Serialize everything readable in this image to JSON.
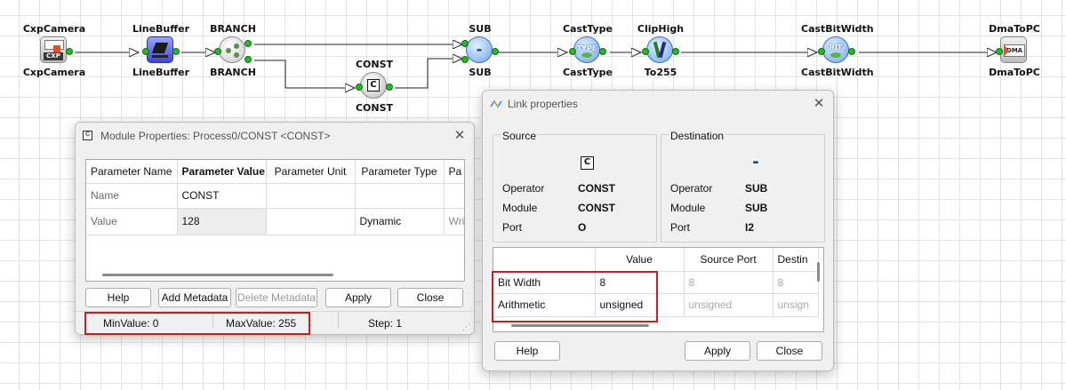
{
  "pipeline": {
    "nodes": {
      "cxp": {
        "top": "CxpCamera",
        "bottom": "CxpCamera",
        "icon": "camera-icon",
        "badge": "CXP"
      },
      "lb": {
        "top": "LineBuffer",
        "bottom": "LineBuffer",
        "icon": "linebuffer-icon"
      },
      "branch": {
        "top": "BRANCH",
        "bottom": "BRANCH",
        "icon": "branch-icon"
      },
      "const": {
        "top": "CONST",
        "bottom": "CONST",
        "icon": "const-icon",
        "glyph": "C"
      },
      "sub": {
        "top": "SUB",
        "bottom": "SUB",
        "icon": "subtract-icon",
        "glyph": "-"
      },
      "cast": {
        "top": "CastType",
        "bottom": "CastType",
        "icon": "casttype-icon",
        "glyph": "TYPE"
      },
      "clip": {
        "top": "ClipHigh",
        "bottom": "To255",
        "icon": "cliphigh-icon"
      },
      "cbw": {
        "top": "CastBitWidth",
        "bottom": "CastBitWidth",
        "icon": "castbitwidth-icon",
        "glyph": "BIT"
      },
      "dma": {
        "top": "DmaToPC",
        "bottom": "DmaToPC",
        "icon": "dma-icon",
        "glyph": "DMA"
      }
    }
  },
  "module_props": {
    "title": "Module Properties: Process0/CONST <CONST>",
    "columns": [
      "Parameter Name",
      "Parameter Value",
      "Parameter Unit",
      "Parameter Type",
      "Pa"
    ],
    "rows": [
      {
        "name": "Name",
        "value": "CONST",
        "unit": "",
        "type": "",
        "extra": ""
      },
      {
        "name": "Value",
        "value": "128",
        "unit": "",
        "type": "Dynamic",
        "extra": "Wri"
      }
    ],
    "buttons": {
      "help": "Help",
      "add_meta": "Add Metadata",
      "del_meta": "Delete Metadata",
      "apply": "Apply",
      "close": "Close"
    },
    "status": {
      "min": "MinValue: 0",
      "max": "MaxValue: 255",
      "step": "Step: 1"
    }
  },
  "link_props": {
    "title": "Link properties",
    "source": {
      "heading": "Source",
      "glyph": "C",
      "operator_label": "Operator",
      "operator": "CONST",
      "module_label": "Module",
      "module": "CONST",
      "port_label": "Port",
      "port": "O"
    },
    "destination": {
      "heading": "Destination",
      "glyph": "-",
      "operator_label": "Operator",
      "operator": "SUB",
      "module_label": "Module",
      "module": "SUB",
      "port_label": "Port",
      "port": "I2"
    },
    "columns": [
      "",
      "Value",
      "Source Port",
      "Destin"
    ],
    "rows": [
      {
        "name": "Bit Width",
        "value": "8",
        "src": "8",
        "dst": "8"
      },
      {
        "name": "Arithmetic",
        "value": "unsigned",
        "src": "unsigned",
        "dst": "unsign"
      }
    ],
    "buttons": {
      "help": "Help",
      "apply": "Apply",
      "close": "Close"
    }
  },
  "colors": {
    "highlight": "#d11a1a",
    "port": "#2bb52b"
  }
}
